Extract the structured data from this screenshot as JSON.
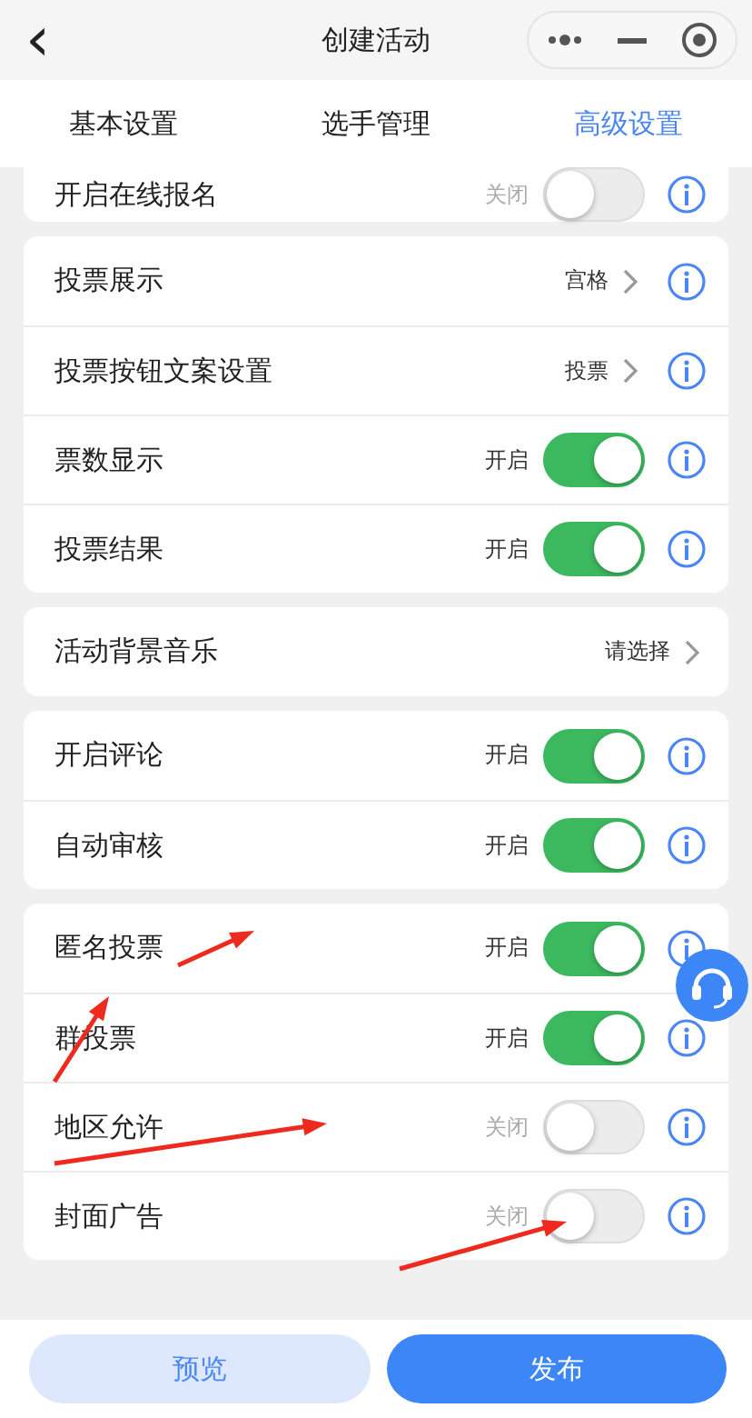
{
  "header": {
    "back": "‹",
    "title": "创建活动"
  },
  "tabs": [
    {
      "label": "基本设置",
      "selected": false
    },
    {
      "label": "选手管理",
      "selected": false
    },
    {
      "label": "高级设置",
      "selected": true
    }
  ],
  "groups": [
    {
      "rows": [
        {
          "kind": "toggle",
          "label": "开启在线报名",
          "value": "关闭",
          "on": false,
          "info": true
        }
      ]
    },
    {
      "rows": [
        {
          "kind": "select",
          "label": "投票展示",
          "value": "宫格",
          "info": true
        },
        {
          "kind": "select",
          "label": "投票按钮文案设置",
          "value": "投票",
          "info": true
        },
        {
          "kind": "toggle",
          "label": "票数显示",
          "value": "开启",
          "on": true,
          "info": true
        },
        {
          "kind": "toggle",
          "label": "投票结果",
          "value": "开启",
          "on": true,
          "info": true
        }
      ]
    },
    {
      "rows": [
        {
          "kind": "select",
          "label": "活动背景音乐",
          "value": "请选择",
          "info": false
        }
      ]
    },
    {
      "rows": [
        {
          "kind": "toggle",
          "label": "开启评论",
          "value": "开启",
          "on": true,
          "info": true
        },
        {
          "kind": "toggle",
          "label": "自动审核",
          "value": "开启",
          "on": true,
          "info": true
        }
      ]
    },
    {
      "rows": [
        {
          "kind": "toggle",
          "label": "匿名投票",
          "value": "开启",
          "on": true,
          "info": true
        },
        {
          "kind": "toggle",
          "label": "群投票",
          "value": "开启",
          "on": true,
          "info": true
        },
        {
          "kind": "toggle",
          "label": "地区允许",
          "value": "关闭",
          "on": false,
          "info": true
        },
        {
          "kind": "toggle",
          "label": "封面广告",
          "value": "关闭",
          "on": false,
          "info": true
        }
      ]
    }
  ],
  "buttons": [
    {
      "kind": "secondary",
      "label": "预览"
    },
    {
      "kind": "primary",
      "label": "发布"
    }
  ]
}
